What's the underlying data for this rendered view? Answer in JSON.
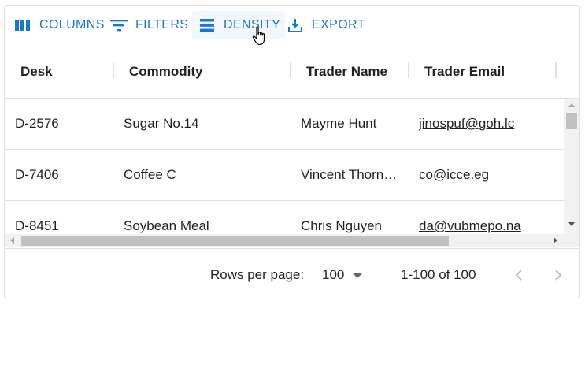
{
  "toolbar": {
    "columns_label": "Columns",
    "filters_label": "Filters",
    "density_label": "Density",
    "export_label": "Export"
  },
  "columns": [
    {
      "label": "Desk"
    },
    {
      "label": "Commodity"
    },
    {
      "label": "Trader Name"
    },
    {
      "label": "Trader Email"
    }
  ],
  "rows": [
    {
      "desk": "D-2576",
      "commodity": "Sugar No.14",
      "trader_name": "Mayme Hunt",
      "trader_email": "jinospuf@goh.lc"
    },
    {
      "desk": "D-7406",
      "commodity": "Coffee C",
      "trader_name": "Vincent Thorn…",
      "trader_email": "co@icce.eg"
    },
    {
      "desk": "D-8451",
      "commodity": "Soybean Meal",
      "trader_name": "Chris Nguyen",
      "trader_email": "da@vubmepo.na"
    }
  ],
  "footer": {
    "rows_per_page_label": "Rows per page:",
    "rows_per_page_value": "100",
    "range_label": "1-100 of 100"
  },
  "colors": {
    "accent": "#1976d2",
    "border": "#e0e0e0",
    "scroll_track": "#f1f1f1",
    "scroll_thumb": "#c1c1c1"
  }
}
